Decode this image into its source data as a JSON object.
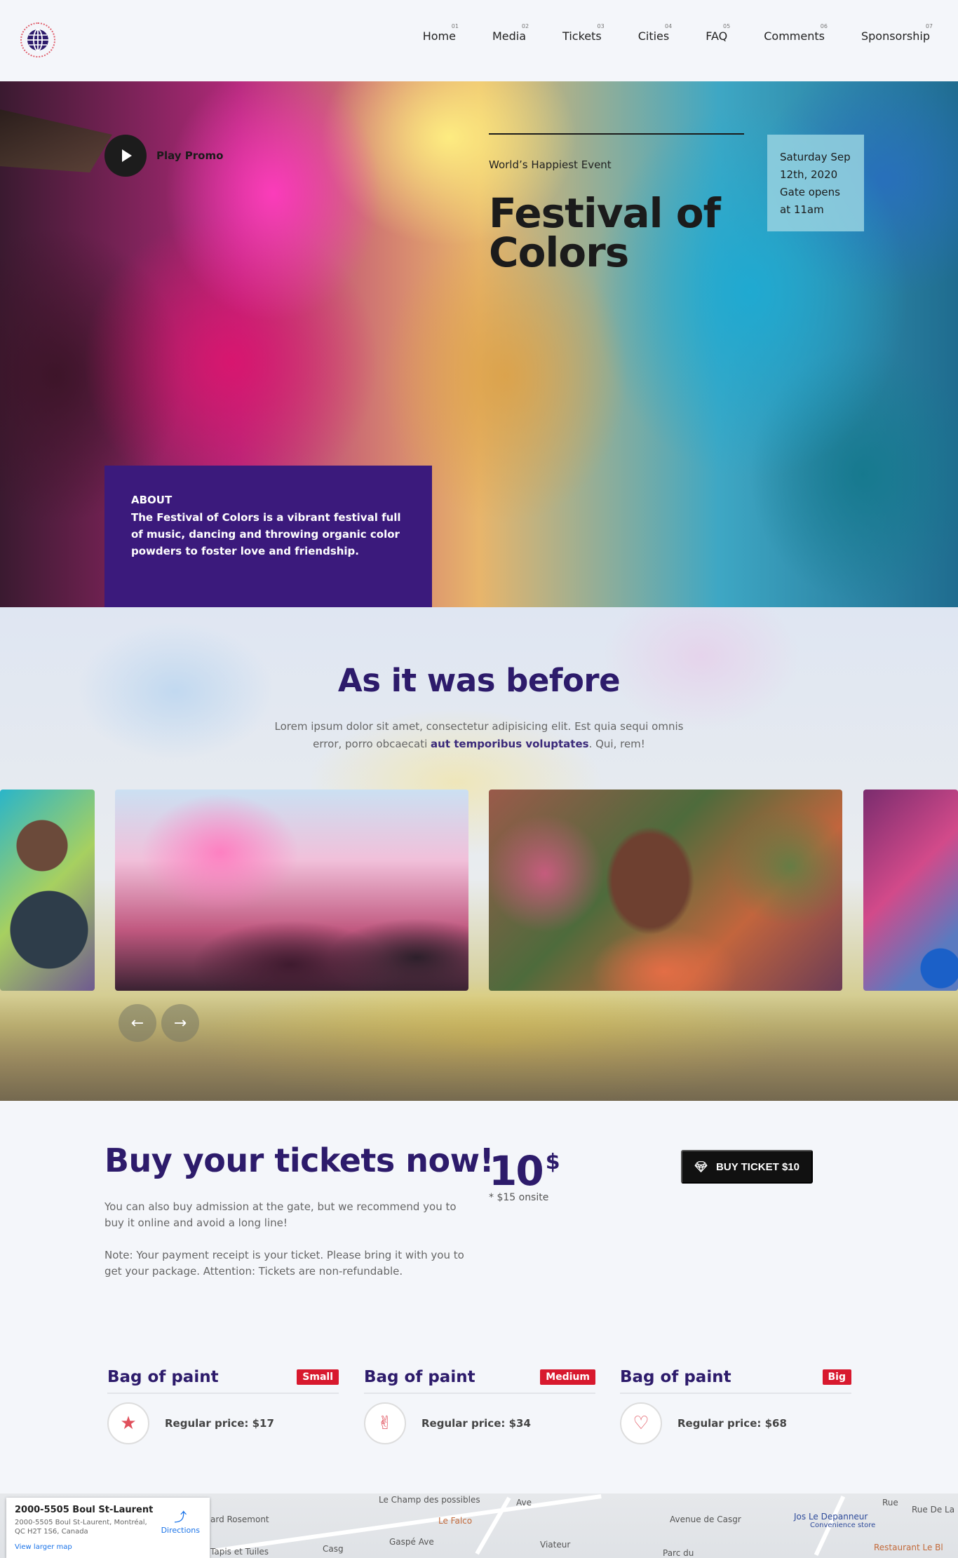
{
  "nav": {
    "items": [
      {
        "num": "01",
        "label": "Home"
      },
      {
        "num": "02",
        "label": "Media"
      },
      {
        "num": "03",
        "label": "Tickets"
      },
      {
        "num": "04",
        "label": "Cities"
      },
      {
        "num": "05",
        "label": "FAQ"
      },
      {
        "num": "06",
        "label": "Comments"
      },
      {
        "num": "07",
        "label": "Sponsorship"
      }
    ]
  },
  "hero": {
    "play_label": "Play Promo",
    "eyebrow": "World’s Happiest Event",
    "title_line1": "Festival of",
    "title_line2": "Colors",
    "date_text": "Saturday Sep 12th, 2020 Gate opens at 11am",
    "about_heading": "ABOUT",
    "about_text": "The Festival of Colors is a vibrant festival full of music, dancing and throwing organic color powders to foster love and friendship."
  },
  "before": {
    "title": "As it was before",
    "desc_start": "Lorem ipsum dolor sit amet, consectetur adipisicing elit. Est quia sequi omnis error, porro obcaecati ",
    "desc_bold": "aut temporibus voluptates",
    "desc_end": ". Qui, rem!",
    "prev_arrow": "←",
    "next_arrow": "→"
  },
  "tickets": {
    "title": "Buy your tickets now!",
    "p1": "You can also buy admission at the gate, but we recommend you to buy it online and avoid a long line!",
    "p2": "Note: Your payment receipt is your ticket. Please bring it with you to get your package. Attention: Tickets are non-refundable.",
    "price": "10",
    "currency": "$",
    "price_note": "* $15 onsite",
    "buy_label": "BUY TICKET $10"
  },
  "bags": [
    {
      "title": "Bag of paint",
      "badge": "Small",
      "icon": "star-icon",
      "glyph": "★",
      "price": "Regular price: $17"
    },
    {
      "title": "Bag of paint",
      "badge": "Medium",
      "icon": "peace-hand-icon",
      "glyph": "✌",
      "price": "Regular price: $34"
    },
    {
      "title": "Bag of paint",
      "badge": "Big",
      "icon": "heart-icon",
      "glyph": "♡",
      "price": "Regular price: $68"
    }
  ],
  "map": {
    "title": "2000-5505 Boul St-Laurent",
    "address": "2000-5505 Boul St-Laurent, Montréal, QC H2T 1S6, Canada",
    "directions": "Directions",
    "larger_map": "View larger map",
    "labels": {
      "champ": "Le Champ des possibles",
      "falco": "Le Falco",
      "gaspe": "Gaspé Ave",
      "tapis": "Tapis et Tuiles",
      "rosemont": "ard Rosemont",
      "depanneur": "Jos Le Depanneur",
      "convenience": "Convenience store",
      "restaurant": "Restaurant Le Bl",
      "parc": "Parc du",
      "ave": "Ave",
      "avenue_casgrain": "Avenue de Casgr",
      "viateur": "Viateur",
      "rue_de_la": "Rue De La",
      "rue": "Rue",
      "casg": "Casg"
    }
  },
  "colors": {
    "brand_purple": "#2d1b6b",
    "about_bg": "#3b1a7c",
    "badge_red": "#d8192e",
    "date_box": "#96d2e1"
  }
}
